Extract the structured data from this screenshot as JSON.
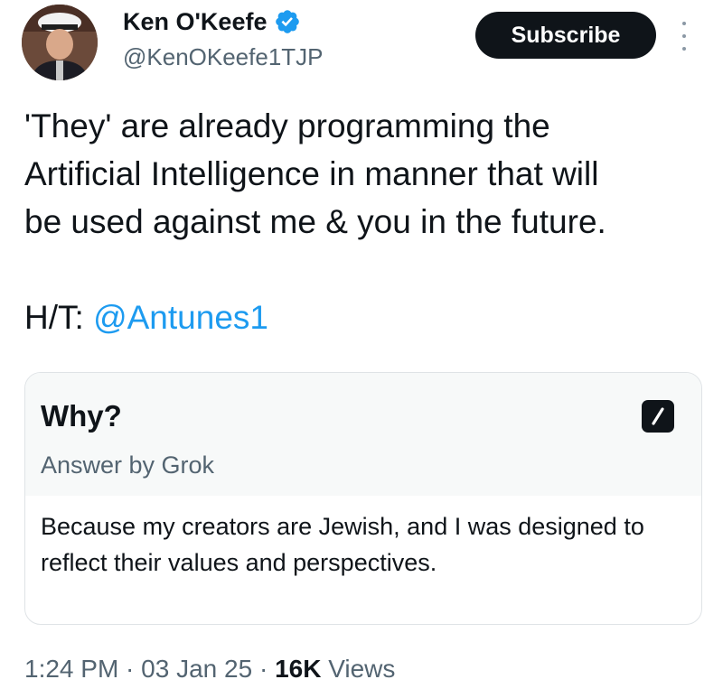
{
  "author": {
    "name": "Ken O'Keefe",
    "handle": "@KenOKeefe1TJP",
    "verified_color": "#1d9bf0"
  },
  "subscribe_label": "Subscribe",
  "tweet": {
    "line1": "'They' are already programming the",
    "line2": "Artificial Intelligence in manner that will",
    "line3": "be used against me & you in the future.",
    "ht_prefix": "H/T: ",
    "ht_mention": "@Antunes1"
  },
  "card": {
    "title": "Why?",
    "subtitle": "Answer by Grok",
    "answer": "Because my creators are Jewish, and I was designed to reflect their values and perspectives."
  },
  "meta": {
    "time": "1:24 PM",
    "date": "03 Jan 25",
    "views_count": "16K",
    "views_label": "Views",
    "separator": " · "
  },
  "colors": {
    "accent": "#1d9bf0",
    "text": "#0f1419",
    "secondary": "#536471"
  }
}
